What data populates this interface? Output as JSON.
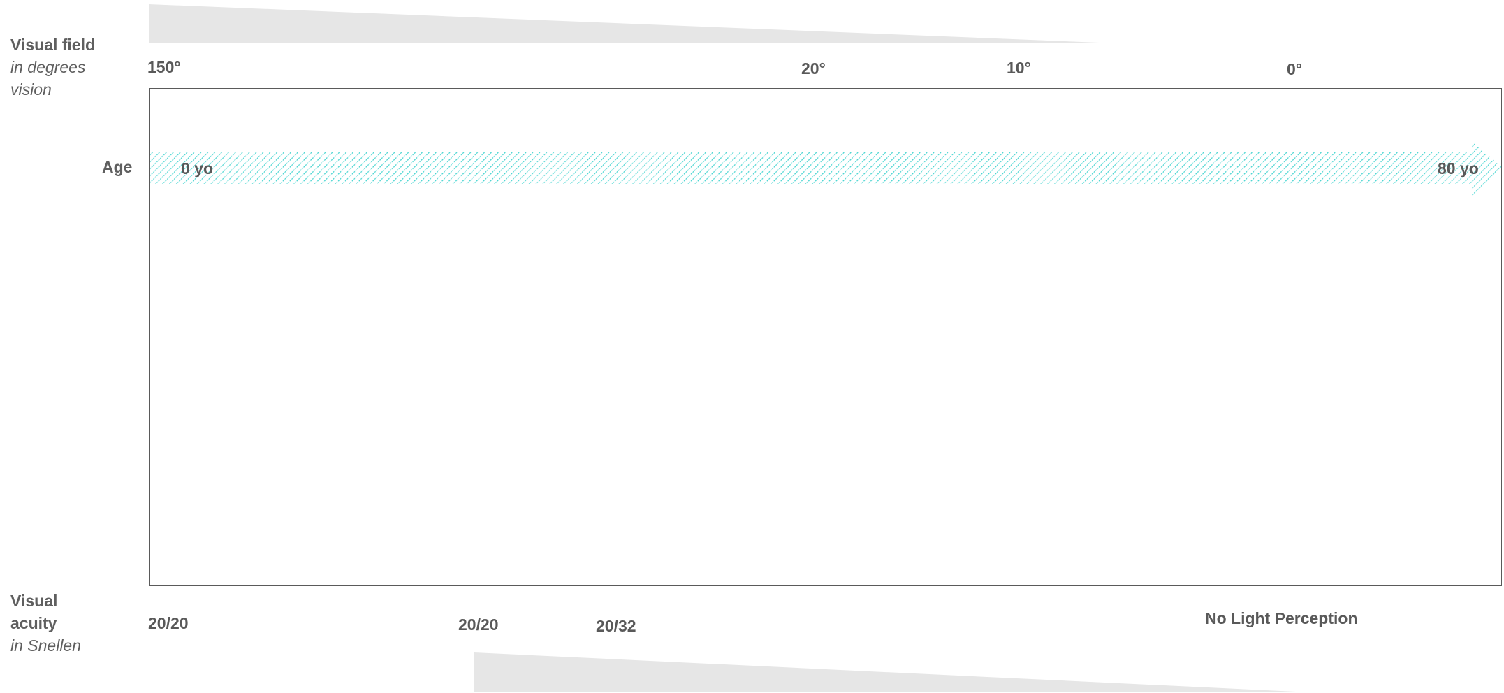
{
  "visual_field": {
    "title": "Visual field",
    "subtitle_line1": "in degrees",
    "subtitle_line2": "vision",
    "ticks": [
      "150°",
      "20°",
      "10°",
      "0°"
    ]
  },
  "age": {
    "label": "Age",
    "start": "0 yo",
    "end": "80 yo"
  },
  "visual_acuity": {
    "title_line1": "Visual",
    "title_line2": "acuity",
    "subtitle": "in Snellen",
    "ticks": [
      "20/20",
      "20/20",
      "20/32",
      "No Light Perception"
    ]
  },
  "colors": {
    "arrow_hatch": "#3fd3cf",
    "wedge": "#e6e6e6",
    "frame": "#5a5a5a",
    "text": "#5f5f5f"
  }
}
